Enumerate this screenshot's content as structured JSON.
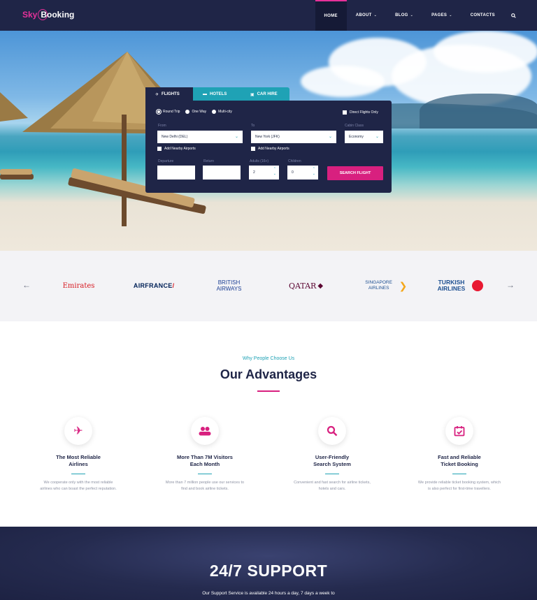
{
  "header": {
    "logo_sky": "Sky",
    "logo_booking": "Booking",
    "nav": [
      {
        "label": "HOME"
      },
      {
        "label": "ABOUT"
      },
      {
        "label": "BLOG"
      },
      {
        "label": "PAGES"
      },
      {
        "label": "CONTACTS"
      }
    ]
  },
  "search": {
    "tabs": [
      {
        "label": "FLIGHTS"
      },
      {
        "label": "HOTELS"
      },
      {
        "label": "CAR HIRE"
      }
    ],
    "trip_types": [
      "Round Trip",
      "One Way",
      "Multi-city"
    ],
    "direct_only": "Direct Flights Only",
    "from_label": "From",
    "from_value": "New Delhi (DEL)",
    "to_label": "To",
    "to_value": "New York (JFK)",
    "cabin_label": "Cabin Class",
    "cabin_value": "Economy",
    "nearby_from": "Add Nearby Airports",
    "nearby_to": "Add Nearby Airports",
    "departure_label": "Departure",
    "return_label": "Return",
    "adults_label": "Adults (16+)",
    "adults_value": "2",
    "children_label": "Children",
    "children_value": "0",
    "button": "SEARCH FLIGHT"
  },
  "airlines": [
    {
      "name": "Emirates"
    },
    {
      "name": "AIRFRANCE"
    },
    {
      "name": "BRITISH AIRWAYS"
    },
    {
      "name": "QATAR"
    },
    {
      "name": "SINGAPORE AIRLINES"
    },
    {
      "name": "TURKISH AIRLINES"
    }
  ],
  "advantages": {
    "kicker": "Why People Choose Us",
    "title": "Our Advantages",
    "items": [
      {
        "icon": "plane-icon",
        "title_1": "The Most Reliable",
        "title_2": "Airlines",
        "text_1": "We cooperate only with the most reliable",
        "text_2": "airlines who can boast the perfect reputation."
      },
      {
        "icon": "users-icon",
        "title_1": "More Than 7M Visitors",
        "title_2": "Each Month",
        "text_1": "More than 7 million people use our services to",
        "text_2": "find and book airline tickets."
      },
      {
        "icon": "search-icon",
        "title_1": "User-Friendly",
        "title_2": "Search System",
        "text_1": "Convenient and fast search for airline tickets,",
        "text_2": "hotels and cars."
      },
      {
        "icon": "calendar-check-icon",
        "title_1": "Fast and Reliable",
        "title_2": "Ticket Booking",
        "text_1": "We provide reliable ticket booking system, which",
        "text_2": "is also perfect for first-time travellers."
      }
    ]
  },
  "support": {
    "title": "24/7 SUPPORT",
    "text": "Our Support Service is available 24 hours a day, 7 days a week to"
  },
  "colors": {
    "navy": "#1f2547",
    "accent": "#d8207f",
    "teal": "#1fa2b5"
  }
}
